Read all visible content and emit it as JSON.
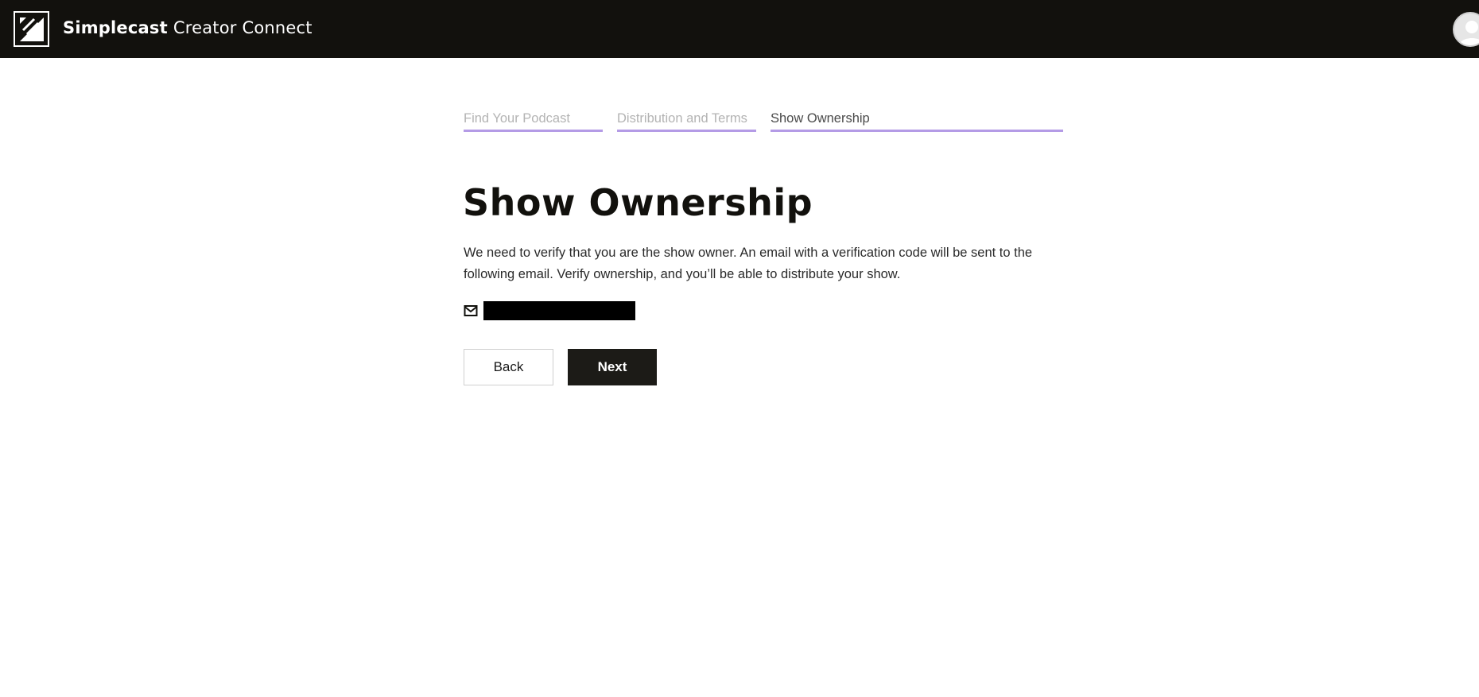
{
  "header": {
    "brand_bold": "Simplecast",
    "brand_regular": "Creator Connect",
    "logo_icon": "simplecast-logo-icon",
    "avatar_icon": "user-avatar-icon"
  },
  "steps": [
    {
      "label": "Find Your Podcast",
      "state": "done"
    },
    {
      "label": "Distribution and Terms",
      "state": "done"
    },
    {
      "label": "Show Ownership",
      "state": "active"
    }
  ],
  "main": {
    "title": "Show Ownership",
    "description": "We need to verify that you are the show owner. An email with a verification code will be sent to the following email. Verify ownership, and you’ll be able to distribute your show.",
    "email_icon": "mail-icon",
    "email_value": "",
    "back_label": "Back",
    "next_label": "Next"
  },
  "colors": {
    "topbar": "#12110d",
    "step_underline": "#b49be6",
    "primary_button": "#1c1b17"
  }
}
